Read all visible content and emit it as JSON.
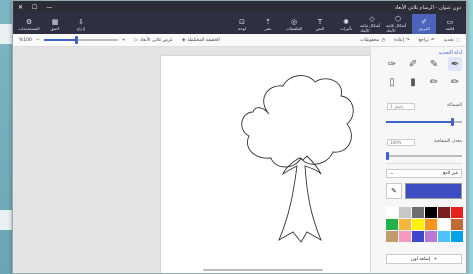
{
  "window": {
    "title": "دون عنوان - الرسام ثلاثي الأبعاد",
    "minimize": "—",
    "maximize": "☐",
    "close": "✕"
  },
  "ribbon": {
    "left_buttons": [
      {
        "label": "المستخدمات",
        "icon": "⚙"
      },
      {
        "label": "لاصق",
        "icon": "▦"
      },
      {
        "label": "إدراج",
        "icon": "⇩"
      }
    ],
    "right_buttons": [
      {
        "label": "لوحة",
        "icon": "⊡"
      },
      {
        "label": "نشر",
        "icon": "⇡"
      },
      {
        "label": "الملصقات",
        "icon": "◎"
      },
      {
        "label": "النص",
        "icon": "T"
      },
      {
        "label": "تأثيرات",
        "icon": "✺"
      },
      {
        "label": "أشكال ثنائية الأبعاد",
        "icon": "◇"
      },
      {
        "label": "أشكال ثلاثية الأبعاد",
        "icon": "⬡"
      },
      {
        "label": "الفرش",
        "icon": "✐",
        "active": true
      },
      {
        "label": "قائمة",
        "icon": "▭"
      }
    ]
  },
  "toolbar": {
    "zoom_value": "%100",
    "zoom_fraction": 0.45,
    "view3d": "عرض ثلاثي الأبعاد",
    "mixed_reality": "الحقيقة المختلطة",
    "history": "محفوظات",
    "redo": "إعادة",
    "undo": "تراجع",
    "select": "تحديد"
  },
  "panel": {
    "title": "أداة التحديد",
    "thickness_label": "السماكة",
    "thickness_value": "1 بكسل",
    "thickness_fraction": 0.88,
    "opacity_label": "معدل الشفافية",
    "opacity_value": "100%",
    "opacity_fraction": 0.02,
    "finish_label": "غير لامع",
    "finish_arrow": "⌄",
    "eyedropper_icon": "✎",
    "current_color": "#3e4ec2",
    "add_color_label": "إضافة لون",
    "add_color_icon": "+"
  },
  "palette": [
    "#ffffff",
    "#c8c8c8",
    "#6e6e6e",
    "#000000",
    "#7a1f1f",
    "#e8201b",
    "#22b14c",
    "#f8b53c",
    "#fff200",
    "#f7931e",
    "#ffffff",
    "#c06b37",
    "#c39a6a",
    "#f49ac1",
    "#3f48cc",
    "#b97ad7",
    "#4fc3f7",
    "#00a2e8"
  ]
}
